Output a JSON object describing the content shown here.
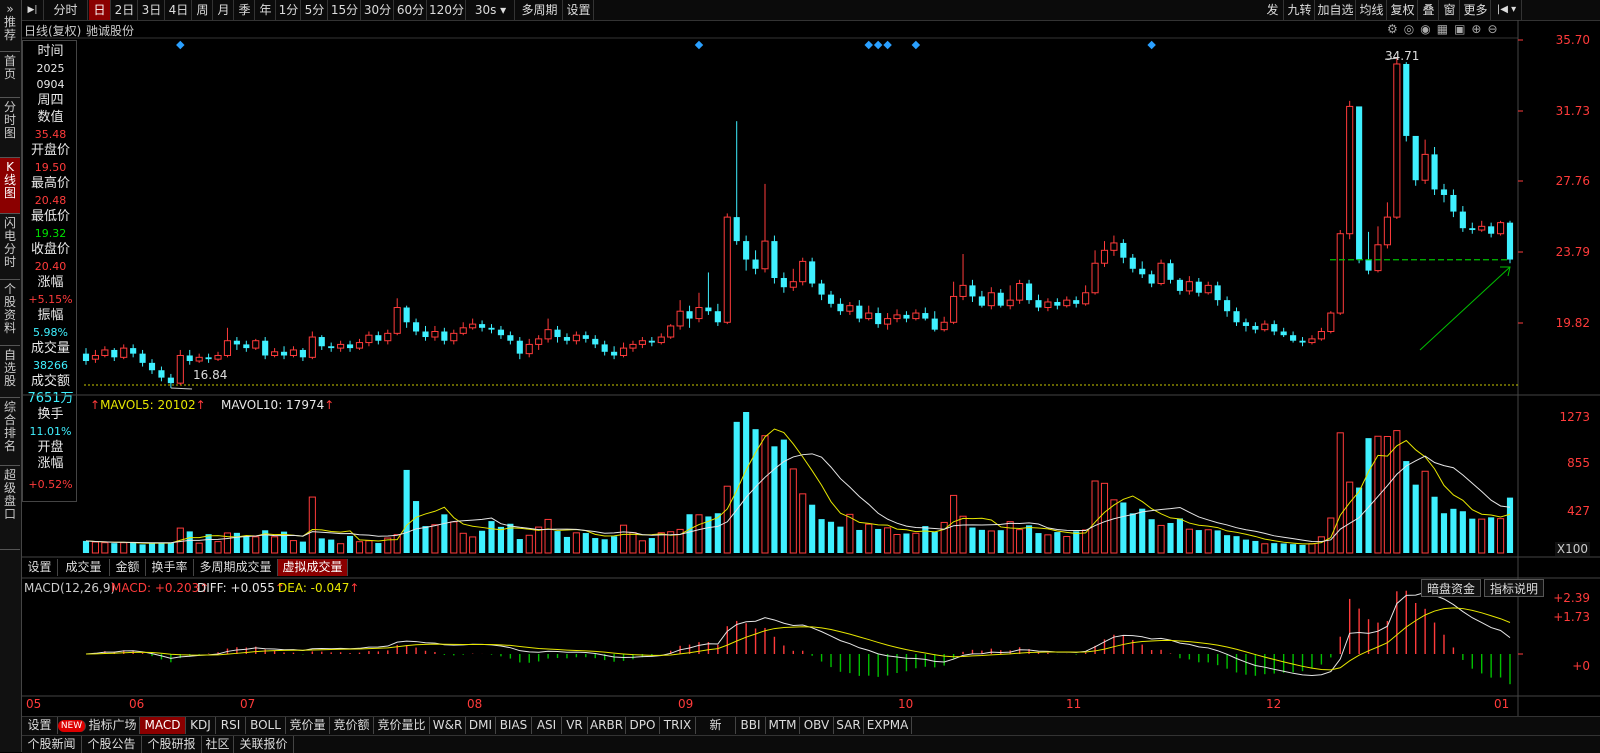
{
  "toolbar": {
    "left_items": [
      "分时",
      "日",
      "2日",
      "3日",
      "4日",
      "周",
      "月",
      "季",
      "年",
      "1分",
      "5分",
      "15分",
      "30分",
      "60分",
      "120分",
      "30s",
      "多周期",
      "设置"
    ],
    "active": "日",
    "right_items": [
      "发",
      "九转",
      "加自选",
      "均线",
      "复权",
      "叠",
      "窗",
      "更多"
    ],
    "play_icon": "play-step-icon",
    "back_icon": "back-step-icon"
  },
  "leftnav": [
    "推荐",
    "首页",
    "分时图",
    "K线图",
    "闪电分时",
    "个股资料",
    "自选股",
    "综合排名",
    "超级盘口"
  ],
  "chart_header": {
    "mode": "日线(复权)",
    "stock": "驰诚股份"
  },
  "info": {
    "labels": [
      "时间",
      "周四",
      "数值",
      "开盘价",
      "最高价",
      "最低价",
      "收盘价",
      "涨幅",
      "振幅",
      "成交量",
      "成交额",
      "换手",
      "开盘涨幅"
    ],
    "time": [
      "2025",
      "0904"
    ],
    "weekday": "周四",
    "value": "35.48",
    "open": "19.50",
    "high": "20.48",
    "low": "19.32",
    "close": "20.40",
    "change": "+5.15%",
    "amplitude": "5.98%",
    "volume": "38266",
    "amount": "7651万",
    "turnover": "11.01%",
    "open_change": "+0.52%"
  },
  "price_axis": [
    "35.70",
    "31.73",
    "27.76",
    "23.79",
    "19.82"
  ],
  "price_annotations": {
    "high": "34.71",
    "low": "16.84"
  },
  "volume_header": {
    "mavol5": "MAVOL5: 20102",
    "mavol10": "MAVOL10: 17974"
  },
  "volume_axis": [
    "1273",
    "855",
    "427",
    "X100"
  ],
  "volume_tabs": [
    "设置",
    "成交量",
    "金额",
    "换手率",
    "多周期成交量",
    "虚拟成交量"
  ],
  "volume_tabs_active": "虚拟成交量",
  "macd_header": {
    "name": "MACD(12,26,9)",
    "macd": "MACD: +0.203",
    "diff": "DIFF: +0.055",
    "dea": "DEA: -0.047"
  },
  "macd_buttons": [
    "暗盘资金",
    "指标说明"
  ],
  "macd_axis": [
    "+2.39",
    "+1.73",
    "+0"
  ],
  "months": [
    "05",
    "06",
    "07",
    "08",
    "09",
    "10",
    "11",
    "12",
    "01"
  ],
  "indicator_tabs": [
    "设置",
    "NEW",
    "指标广场",
    "MACD",
    "KDJ",
    "RSI",
    "BOLL",
    "竞价量",
    "竞价额",
    "竞价量比",
    "W&R",
    "DMI",
    "BIAS",
    "ASI",
    "VR",
    "ARBR",
    "DPO",
    "TRIX",
    "新DMA",
    "BBI",
    "MTM",
    "OBV",
    "SAR",
    "EXPMA"
  ],
  "indicator_active": "MACD",
  "bottom_tabs": [
    "个股新闻",
    "个股公告",
    "个股研报",
    "社区",
    "关联报价"
  ],
  "colors": {
    "up": "#ff3b3b",
    "down": "#3ff0ff",
    "ma_white": "#e6e6e6",
    "ma_yellow": "#e6e600",
    "accent": "#8b0000",
    "support_line": "#00c000"
  },
  "chart_data": {
    "type": "candlestick",
    "ylim": [
      17.0,
      35.7
    ],
    "candles": [
      [
        18.7,
        18.3,
        19.0,
        18.1
      ],
      [
        18.4,
        18.6,
        18.9,
        18.2
      ],
      [
        18.6,
        18.9,
        19.1,
        18.5
      ],
      [
        18.9,
        18.5,
        19.0,
        18.3
      ],
      [
        18.5,
        19.0,
        19.2,
        18.4
      ],
      [
        19.0,
        18.7,
        19.2,
        18.5
      ],
      [
        18.7,
        18.2,
        18.9,
        18.0
      ],
      [
        18.2,
        17.8,
        18.4,
        17.6
      ],
      [
        17.8,
        17.4,
        18.0,
        17.2
      ],
      [
        17.4,
        17.1,
        17.6,
        16.84
      ],
      [
        17.1,
        18.6,
        18.9,
        17.0
      ],
      [
        18.6,
        18.3,
        18.9,
        18.1
      ],
      [
        18.3,
        18.5,
        18.7,
        18.2
      ],
      [
        18.5,
        18.4,
        18.7,
        18.2
      ],
      [
        18.4,
        18.6,
        18.8,
        18.3
      ],
      [
        18.6,
        19.4,
        20.1,
        18.5
      ],
      [
        19.4,
        19.2,
        19.6,
        18.9
      ],
      [
        19.2,
        19.0,
        19.4,
        18.8
      ],
      [
        19.0,
        19.4,
        19.5,
        18.9
      ],
      [
        19.4,
        18.6,
        19.6,
        18.4
      ],
      [
        18.6,
        18.8,
        19.0,
        18.5
      ],
      [
        18.8,
        18.6,
        19.1,
        18.4
      ],
      [
        18.6,
        18.9,
        19.1,
        18.5
      ],
      [
        18.9,
        18.5,
        19.0,
        18.3
      ],
      [
        18.5,
        19.6,
        19.9,
        18.4
      ],
      [
        19.6,
        19.1,
        19.7,
        18.9
      ],
      [
        19.1,
        19.0,
        19.3,
        18.8
      ],
      [
        19.0,
        19.2,
        19.4,
        18.8
      ],
      [
        19.2,
        19.0,
        19.4,
        18.8
      ],
      [
        19.0,
        19.3,
        19.5,
        18.9
      ],
      [
        19.3,
        19.7,
        19.9,
        19.1
      ],
      [
        19.7,
        19.4,
        19.9,
        19.2
      ],
      [
        19.4,
        19.8,
        20.0,
        19.2
      ],
      [
        19.8,
        21.2,
        21.7,
        19.7
      ],
      [
        21.2,
        20.4,
        21.3,
        20.1
      ],
      [
        20.4,
        19.9,
        20.6,
        19.7
      ],
      [
        19.9,
        19.6,
        20.2,
        19.4
      ],
      [
        19.6,
        19.9,
        20.2,
        19.4
      ],
      [
        19.9,
        19.4,
        20.1,
        19.2
      ],
      [
        19.4,
        19.8,
        20.0,
        19.2
      ],
      [
        19.8,
        20.1,
        20.4,
        19.7
      ],
      [
        20.1,
        20.3,
        20.6,
        20.0
      ],
      [
        20.3,
        20.1,
        20.5,
        19.9
      ],
      [
        20.1,
        20.0,
        20.3,
        19.8
      ],
      [
        20.0,
        19.7,
        20.2,
        19.5
      ],
      [
        19.7,
        19.4,
        19.9,
        19.2
      ],
      [
        19.4,
        18.7,
        19.6,
        18.4
      ],
      [
        18.7,
        19.2,
        19.5,
        18.5
      ],
      [
        19.2,
        19.5,
        19.7,
        18.9
      ],
      [
        19.5,
        20.0,
        20.6,
        19.3
      ],
      [
        20.0,
        19.6,
        20.2,
        19.3
      ],
      [
        19.6,
        19.4,
        19.8,
        19.2
      ],
      [
        19.4,
        19.7,
        19.9,
        19.2
      ],
      [
        19.7,
        19.5,
        19.9,
        19.3
      ],
      [
        19.5,
        19.2,
        19.7,
        19.0
      ],
      [
        19.2,
        18.8,
        19.4,
        18.6
      ],
      [
        18.8,
        18.6,
        19.1,
        18.4
      ],
      [
        18.6,
        19.0,
        19.3,
        18.5
      ],
      [
        19.0,
        19.2,
        19.4,
        18.8
      ],
      [
        19.2,
        19.4,
        19.6,
        19.0
      ],
      [
        19.4,
        19.3,
        19.6,
        19.1
      ],
      [
        19.3,
        19.6,
        19.8,
        19.2
      ],
      [
        19.6,
        20.2,
        20.3,
        19.5
      ],
      [
        20.2,
        21.0,
        21.6,
        20.0
      ],
      [
        21.0,
        20.6,
        21.3,
        20.1
      ],
      [
        20.6,
        21.2,
        22.0,
        20.4
      ],
      [
        21.2,
        21.0,
        23.1,
        20.8
      ],
      [
        21.0,
        20.4,
        21.4,
        20.2
      ],
      [
        20.4,
        26.1,
        26.3,
        20.3
      ],
      [
        26.1,
        24.8,
        31.3,
        24.6
      ],
      [
        24.8,
        23.8,
        25.1,
        23.2
      ],
      [
        23.8,
        23.3,
        24.3,
        23.0
      ],
      [
        23.3,
        24.8,
        27.9,
        23.1
      ],
      [
        24.8,
        22.8,
        25.1,
        22.5
      ],
      [
        22.8,
        22.3,
        23.1,
        22.0
      ],
      [
        22.3,
        22.6,
        23.3,
        22.1
      ],
      [
        22.6,
        23.7,
        23.9,
        22.4
      ],
      [
        23.7,
        22.5,
        23.9,
        22.3
      ],
      [
        22.5,
        21.9,
        22.7,
        21.6
      ],
      [
        21.9,
        21.4,
        22.1,
        21.2
      ],
      [
        21.4,
        21.0,
        21.7,
        20.8
      ],
      [
        21.0,
        21.3,
        21.5,
        20.8
      ],
      [
        21.3,
        20.6,
        21.6,
        20.4
      ],
      [
        20.6,
        20.9,
        21.3,
        20.5
      ],
      [
        20.9,
        20.3,
        21.2,
        20.1
      ],
      [
        20.3,
        20.6,
        20.9,
        20.0
      ],
      [
        20.6,
        20.8,
        21.1,
        20.4
      ],
      [
        20.8,
        20.6,
        21.0,
        20.4
      ],
      [
        20.6,
        20.9,
        21.1,
        20.5
      ],
      [
        20.9,
        20.6,
        21.2,
        20.5
      ],
      [
        20.6,
        20.0,
        21.0,
        19.9
      ],
      [
        20.0,
        20.4,
        20.7,
        19.9
      ],
      [
        20.4,
        21.8,
        22.6,
        20.3
      ],
      [
        21.8,
        22.4,
        24.1,
        21.6
      ],
      [
        22.4,
        21.8,
        22.7,
        21.5
      ],
      [
        21.8,
        21.3,
        22.1,
        21.2
      ],
      [
        21.3,
        22.0,
        22.3,
        21.1
      ],
      [
        22.0,
        21.3,
        22.2,
        21.2
      ],
      [
        21.3,
        21.6,
        22.4,
        21.1
      ],
      [
        21.6,
        22.5,
        22.7,
        21.4
      ],
      [
        22.5,
        21.6,
        22.7,
        21.4
      ],
      [
        21.6,
        21.2,
        21.9,
        21.0
      ],
      [
        21.2,
        21.5,
        21.7,
        21.0
      ],
      [
        21.5,
        21.3,
        21.7,
        21.1
      ],
      [
        21.3,
        21.6,
        21.8,
        21.2
      ],
      [
        21.6,
        21.4,
        21.8,
        21.2
      ],
      [
        21.4,
        22.0,
        22.4,
        21.3
      ],
      [
        22.0,
        23.6,
        24.3,
        21.9
      ],
      [
        23.6,
        24.3,
        24.8,
        23.4
      ],
      [
        24.3,
        24.7,
        25.1,
        24.0
      ],
      [
        24.7,
        23.9,
        24.9,
        23.6
      ],
      [
        23.9,
        23.3,
        24.1,
        23.1
      ],
      [
        23.3,
        23.0,
        23.7,
        22.8
      ],
      [
        23.0,
        22.5,
        23.2,
        22.3
      ],
      [
        22.5,
        23.6,
        23.8,
        22.4
      ],
      [
        23.6,
        22.7,
        23.8,
        22.5
      ],
      [
        22.7,
        22.1,
        22.8,
        21.9
      ],
      [
        22.1,
        22.6,
        22.9,
        21.9
      ],
      [
        22.6,
        22.0,
        22.8,
        21.8
      ],
      [
        22.0,
        22.4,
        22.6,
        21.9
      ],
      [
        22.4,
        21.6,
        22.6,
        21.3
      ],
      [
        21.6,
        21.0,
        21.8,
        20.7
      ],
      [
        21.0,
        20.4,
        21.2,
        20.2
      ],
      [
        20.4,
        20.2,
        20.6,
        19.9
      ],
      [
        20.2,
        20.0,
        20.4,
        19.8
      ],
      [
        20.0,
        20.3,
        20.5,
        19.9
      ],
      [
        20.3,
        19.9,
        20.5,
        19.7
      ],
      [
        19.9,
        19.7,
        20.1,
        19.6
      ],
      [
        19.7,
        19.4,
        19.9,
        19.3
      ],
      [
        19.4,
        19.3,
        19.6,
        19.1
      ],
      [
        19.3,
        19.5,
        19.7,
        19.2
      ],
      [
        19.5,
        19.9,
        20.1,
        19.4
      ],
      [
        19.9,
        20.9,
        21.0,
        19.8
      ],
      [
        20.9,
        25.2,
        25.4,
        20.8
      ],
      [
        25.2,
        32.1,
        32.4,
        24.9
      ],
      [
        32.1,
        23.8,
        25.0,
        23.6
      ],
      [
        23.8,
        23.2,
        25.3,
        23.0
      ],
      [
        23.2,
        24.6,
        25.6,
        23.1
      ],
      [
        24.6,
        26.1,
        26.9,
        24.4
      ],
      [
        26.1,
        34.4,
        34.71,
        26.0
      ],
      [
        34.4,
        30.5,
        34.5,
        30.2
      ],
      [
        30.5,
        28.1,
        29.4,
        27.8
      ],
      [
        28.1,
        29.5,
        30.3,
        27.9
      ],
      [
        29.5,
        27.6,
        29.9,
        27.3
      ],
      [
        27.6,
        27.3,
        27.9,
        26.9
      ],
      [
        27.3,
        26.4,
        27.6,
        26.1
      ],
      [
        26.4,
        25.5,
        26.7,
        25.3
      ],
      [
        25.5,
        25.4,
        25.8,
        25.2
      ],
      [
        25.4,
        25.6,
        25.9,
        25.3
      ],
      [
        25.6,
        25.2,
        25.8,
        25.0
      ],
      [
        25.2,
        25.8,
        25.9,
        25.1
      ],
      [
        25.8,
        23.8,
        25.9,
        23.6
      ]
    ],
    "volume": [
      109,
      99,
      93,
      89,
      93,
      94,
      78,
      86,
      94,
      92,
      225,
      195,
      89,
      170,
      103,
      181,
      182,
      153,
      146,
      205,
      146,
      193,
      112,
      103,
      505,
      132,
      121,
      84,
      154,
      102,
      110,
      90,
      135,
      166,
      750,
      469,
      243,
      255,
      349,
      281,
      178,
      145,
      201,
      288,
      236,
      264,
      126,
      160,
      234,
      303,
      198,
      145,
      182,
      180,
      135,
      124,
      151,
      251,
      184,
      110,
      135,
      183,
      192,
      213,
      350,
      345,
      330,
      359,
      603,
      1184,
      1273,
      1118,
      1059,
      963,
      1024,
      759,
      534,
      436,
      306,
      282,
      238,
      349,
      208,
      260,
      217,
      227,
      167,
      176,
      178,
      243,
      192,
      276,
      520,
      332,
      230,
      209,
      199,
      206,
      283,
      211,
      250,
      180,
      164,
      189,
      149,
      196,
      208,
      650,
      629,
      480,
      456,
      358,
      400,
      305,
      249,
      271,
      312,
      215,
      207,
      210,
      204,
      161,
      152,
      121,
      109,
      83,
      89,
      86,
      80,
      73,
      84,
      146,
      316,
      1085,
      640,
      591,
      1037,
      1054,
      1052,
      1105,
      830,
      617,
      738,
      508,
      359,
      399,
      377,
      310,
      306,
      322,
      310,
      500
    ],
    "volume_ylim": [
      0,
      1273
    ],
    "macd_ylim": [
      -0.3,
      2.39
    ],
    "support_price": 23.79
  }
}
